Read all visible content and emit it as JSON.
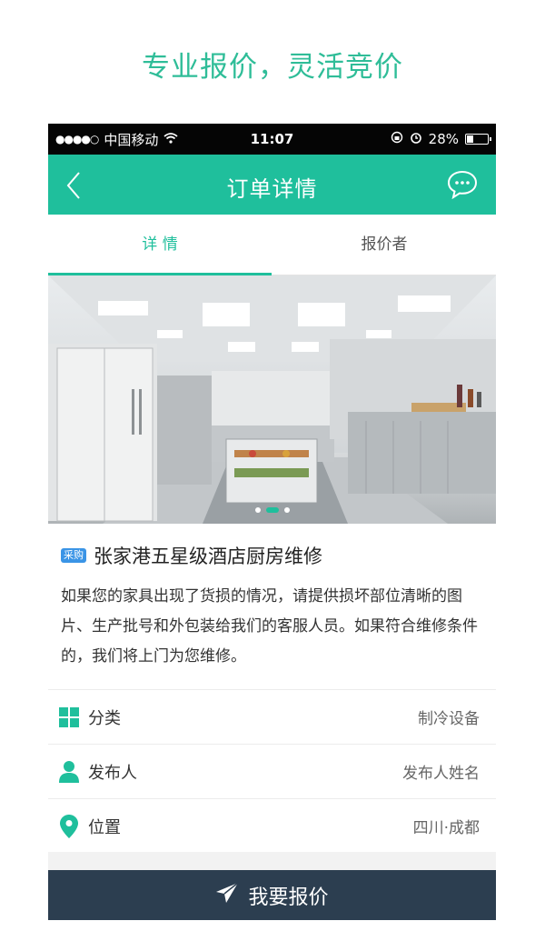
{
  "headline": "专业报价，灵活竞价",
  "status_bar": {
    "carrier": "中国移动",
    "time": "11:07",
    "battery": "28%"
  },
  "navbar": {
    "title": "订单详情",
    "back_icon": "chevron-left-icon",
    "chat_icon": "chat-bubble-icon"
  },
  "tabs": [
    {
      "label": "详 情",
      "active": true
    },
    {
      "label": "报价者",
      "active": false
    }
  ],
  "banner": {
    "pages": 3,
    "current_page": 2
  },
  "order": {
    "tag": "采购",
    "title": "张家港五星级酒店厨房维修",
    "description": "如果您的家具出现了货损的情况，请提供损坏部位清晰的图片、生产批号和外包装给我们的客服人员。如果符合维修条件的，我们将上门为您维修。"
  },
  "details": [
    {
      "icon": "grid-icon",
      "label": "分类",
      "value": "制冷设备"
    },
    {
      "icon": "person-icon",
      "label": "发布人",
      "value": "发布人姓名"
    },
    {
      "icon": "location-pin-icon",
      "label": "位置",
      "value": "四川·成都"
    }
  ],
  "cta": {
    "label": "我要报价",
    "icon": "paper-plane-icon"
  },
  "colors": {
    "accent": "#1fbf9c",
    "headline": "#2fbd98",
    "cta_bg": "#2c3e50",
    "tag_bg": "#3a94e6"
  }
}
